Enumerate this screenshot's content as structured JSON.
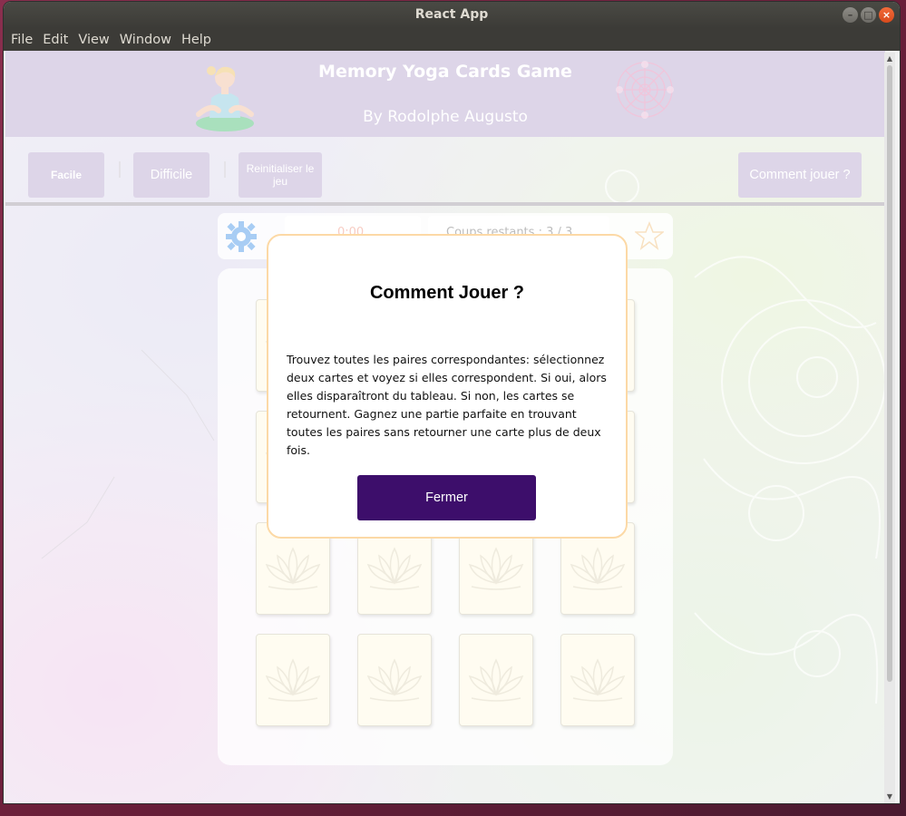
{
  "window": {
    "title": "React App",
    "controls": {
      "minimize": "–",
      "maximize": "□",
      "close": "×"
    }
  },
  "menubar": {
    "items": [
      "File",
      "Edit",
      "View",
      "Window",
      "Help"
    ]
  },
  "header": {
    "title": "Memory Yoga Cards Game",
    "author": "By Rodolphe Augusto",
    "background_color": "#cbbfdc"
  },
  "controls": {
    "easy_label": "Facile",
    "hard_label": "Difficile",
    "reset_label": "Reinitialiser le jeu",
    "how_to_label": "Comment jouer ?"
  },
  "stats": {
    "timer_partial": "0:00",
    "moves_partial": "Coups restants : 3 / 3"
  },
  "board": {
    "card_icon": "lotus-icon",
    "rows": 4,
    "cols": 4
  },
  "modal": {
    "title": "Comment Jouer ?",
    "body": "Trouvez toutes les paires correspondantes: sélectionnez deux cartes et voyez si elles correspondent. Si oui, alors elles disparaîtront du tableau. Si non, les cartes se retournent. Gagnez une partie parfaite en trouvant toutes les paires sans retourner une carte plus de deux fois.",
    "close_label": "Fermer",
    "accent_color": "#3d0e6b",
    "border_color": "#fcd9a6"
  }
}
